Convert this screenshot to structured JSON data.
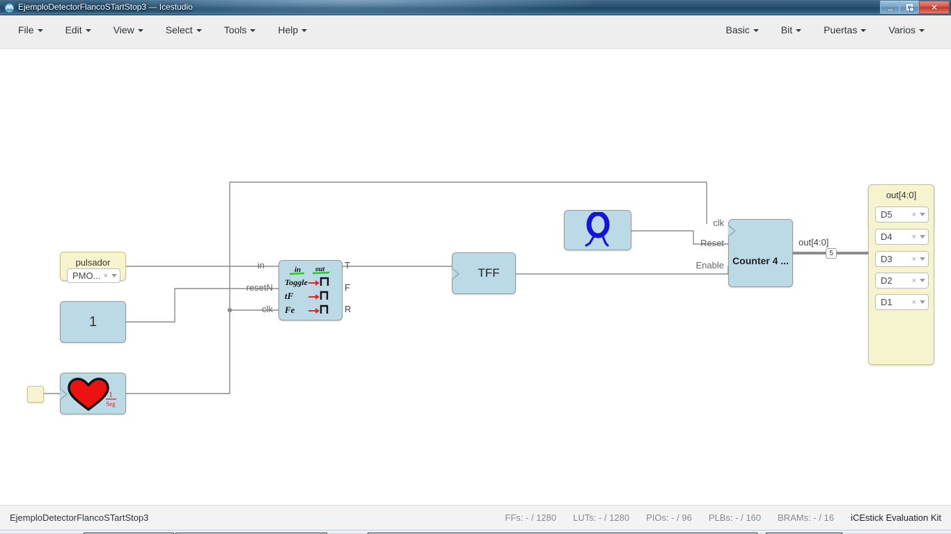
{
  "window": {
    "title": "EjemploDetectorFlancoSTartStop3 — Icestudio",
    "app_icon": "icestudio-icon",
    "minimize_label": "",
    "restore_label": "",
    "close_label": "✕"
  },
  "menubar": {
    "left_items": [
      {
        "label": "File"
      },
      {
        "label": "Edit"
      },
      {
        "label": "View"
      },
      {
        "label": "Select"
      },
      {
        "label": "Tools"
      },
      {
        "label": "Help"
      }
    ],
    "right_items": [
      {
        "label": "Basic"
      },
      {
        "label": "Bit"
      },
      {
        "label": "Puertas"
      },
      {
        "label": "Varios"
      }
    ]
  },
  "canvas": {
    "blocks": {
      "pulsador": {
        "title": "pulsador",
        "select_value": "PMO...",
        "clear_glyph": "×"
      },
      "constant_one": {
        "label": "1"
      },
      "heart": {
        "icon": "heart-icon",
        "rate_numerator": "1",
        "rate_denominator": "Seg"
      },
      "input_stub": {
        "name": "input-pin-stub"
      },
      "edge_detector": {
        "icon": "edge-detector-sketch-icon",
        "sketch": {
          "col_in": "in",
          "col_out": "out",
          "rows": [
            "Toggle",
            "tF",
            "Fe"
          ]
        },
        "inputs": [
          "in",
          "resetN",
          "clk"
        ],
        "outputs": [
          "T",
          "F",
          "R"
        ]
      },
      "tff": {
        "label": "TFF"
      },
      "zero": {
        "icon": "walking-zero-icon",
        "glyph": "0"
      },
      "counter": {
        "label": "Counter 4 ...",
        "inputs": [
          "clk",
          "Reset",
          "Enable"
        ],
        "output": "out[4:0]",
        "bus_width": "5"
      },
      "output_group": {
        "header": "out[4:0]",
        "pins": [
          {
            "label": "D5",
            "clear_glyph": "×"
          },
          {
            "label": "D4",
            "clear_glyph": "×"
          },
          {
            "label": "D3",
            "clear_glyph": "×"
          },
          {
            "label": "D2",
            "clear_glyph": "×"
          },
          {
            "label": "D1",
            "clear_glyph": "×"
          }
        ]
      }
    }
  },
  "statusbar": {
    "project_name": "EjemploDetectorFlancoSTartStop3",
    "resources": [
      {
        "label": "FFs:",
        "value": "- / 1280"
      },
      {
        "label": "LUTs:",
        "value": "- / 1280"
      },
      {
        "label": "PIOs:",
        "value": "- / 96"
      },
      {
        "label": "PLBs:",
        "value": "- / 160"
      },
      {
        "label": "BRAMs:",
        "value": "- / 16"
      }
    ],
    "board": "iCEstick Evaluation Kit"
  },
  "colors": {
    "block_fill": "#bcd9e6",
    "block_border": "#8f9b9f",
    "port_fill": "#f6f4cf",
    "port_border": "#c9c488",
    "wire": "#8c8c8c",
    "titlebar": "#26506e",
    "close_button": "#bf3529",
    "heart": "#ee1111",
    "zero": "#1414dd",
    "sketch_green": "#22cc22",
    "sketch_red": "#ee2222"
  }
}
